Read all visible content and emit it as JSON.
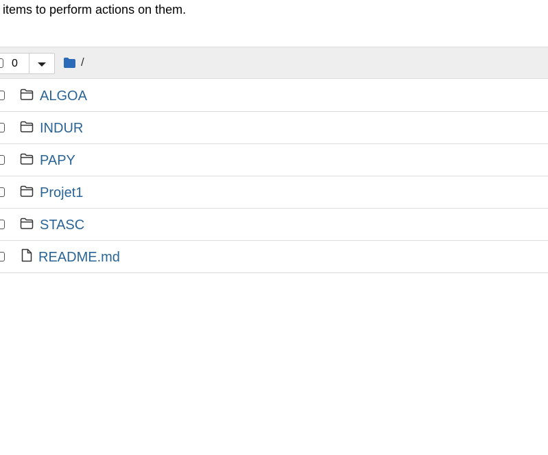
{
  "instructions": "ct items to perform actions on them.",
  "toolbar": {
    "selected_count": "0",
    "breadcrumb_separator": "/"
  },
  "icons": {
    "breadcrumb_root": "folder-solid-icon",
    "folder": "folder-outline-icon",
    "file": "file-outline-icon",
    "dropdown": "caret-down-icon"
  },
  "colors": {
    "link": "#2a6496",
    "folder_solid": "#2a6ab8",
    "toolbar_bg": "#eeeeee",
    "divider": "#dddddd"
  },
  "items": [
    {
      "name": "ALGOA",
      "type": "folder"
    },
    {
      "name": "INDUR",
      "type": "folder"
    },
    {
      "name": "PAPY",
      "type": "folder"
    },
    {
      "name": "Projet1",
      "type": "folder"
    },
    {
      "name": "STASC",
      "type": "folder"
    },
    {
      "name": "README.md",
      "type": "file"
    }
  ]
}
